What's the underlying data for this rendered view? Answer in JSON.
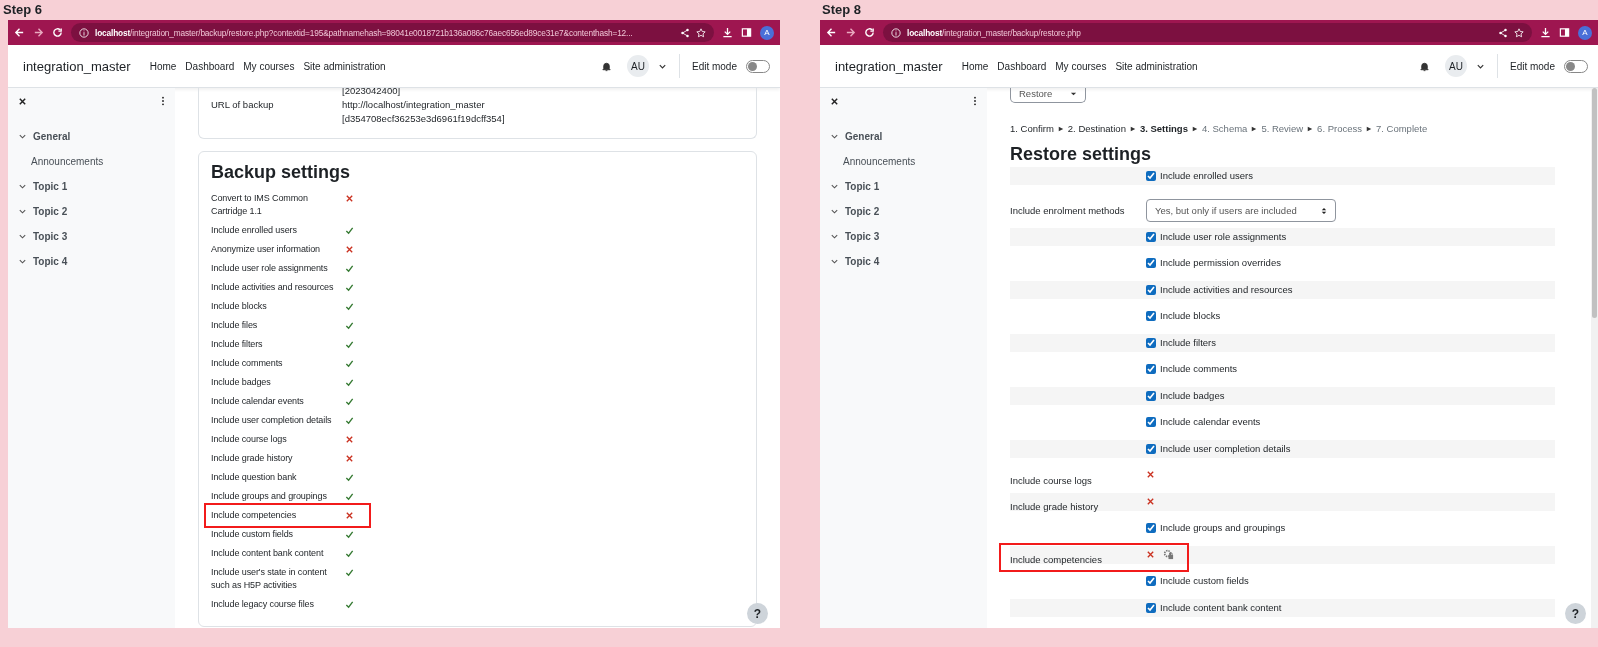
{
  "panels": [
    {
      "kind": "backup",
      "step": "Step 6",
      "url_host": "localhost",
      "url_path": "/integration_master/backup/restore.php?contextid=195&pathnamehash=98041e0018721b136a086c76aec656ed89ce31e7&contenthash=12...",
      "avatar": "A",
      "brand": "integration_master",
      "nav": [
        "Home",
        "Dashboard",
        "My courses",
        "Site administration"
      ],
      "user_initials": "AU",
      "edit_mode": {
        "label": "Edit mode",
        "on": false
      },
      "sidebar": [
        {
          "kind": "section",
          "label": "General"
        },
        {
          "kind": "item",
          "label": "Announcements"
        },
        {
          "kind": "section",
          "label": "Topic 1"
        },
        {
          "kind": "section",
          "label": "Topic 2"
        },
        {
          "kind": "section",
          "label": "Topic 3"
        },
        {
          "kind": "section",
          "label": "Topic 4"
        }
      ],
      "details": [
        {
          "values": [
            "[2023042400]"
          ]
        },
        {
          "label": "URL of backup",
          "values": [
            "http://localhost/integration_master",
            "[d354708ecf36253e3d6961f19dcff354]"
          ]
        }
      ],
      "title": "Backup settings",
      "help_label": "?",
      "settings": [
        {
          "label": "Convert to IMS Common Cartridge 1.1",
          "value": false,
          "highlighted": false
        },
        {
          "label": "Include enrolled users",
          "value": true,
          "highlighted": false
        },
        {
          "label": "Anonymize user information",
          "value": false,
          "highlighted": false
        },
        {
          "label": "Include user role assignments",
          "value": true,
          "highlighted": false
        },
        {
          "label": "Include activities and resources",
          "value": true,
          "highlighted": false
        },
        {
          "label": "Include blocks",
          "value": true,
          "highlighted": false
        },
        {
          "label": "Include files",
          "value": true,
          "highlighted": false
        },
        {
          "label": "Include filters",
          "value": true,
          "highlighted": false
        },
        {
          "label": "Include comments",
          "value": true,
          "highlighted": false
        },
        {
          "label": "Include badges",
          "value": true,
          "highlighted": false
        },
        {
          "label": "Include calendar events",
          "value": true,
          "highlighted": false
        },
        {
          "label": "Include user completion details",
          "value": true,
          "highlighted": false
        },
        {
          "label": "Include course logs",
          "value": false,
          "highlighted": false
        },
        {
          "label": "Include grade history",
          "value": false,
          "highlighted": false
        },
        {
          "label": "Include question bank",
          "value": true,
          "highlighted": false
        },
        {
          "label": "Include groups and groupings",
          "value": true,
          "highlighted": false
        },
        {
          "label": "Include competencies",
          "value": false,
          "highlighted": true
        },
        {
          "label": "Include custom fields",
          "value": true,
          "highlighted": false
        },
        {
          "label": "Include content bank content",
          "value": true,
          "highlighted": false
        },
        {
          "label": "Include user's state in content such as H5P activities",
          "value": true,
          "highlighted": false
        },
        {
          "label": "Include legacy course files",
          "value": true,
          "highlighted": false
        }
      ]
    },
    {
      "kind": "restore",
      "step": "Step 8",
      "url_host": "localhost",
      "url_path": "/integration_master/backup/restore.php",
      "avatar": "A",
      "brand": "integration_master",
      "nav": [
        "Home",
        "Dashboard",
        "My courses",
        "Site administration"
      ],
      "user_initials": "AU",
      "edit_mode": {
        "label": "Edit mode",
        "on": false
      },
      "sidebar": [
        {
          "kind": "section",
          "label": "General"
        },
        {
          "kind": "item",
          "label": "Announcements"
        },
        {
          "kind": "section",
          "label": "Topic 1"
        },
        {
          "kind": "section",
          "label": "Topic 2"
        },
        {
          "kind": "section",
          "label": "Topic 3"
        },
        {
          "kind": "section",
          "label": "Topic 4"
        }
      ],
      "mode_select": "Restore",
      "stepper": [
        {
          "label": "1. Confirm",
          "done": true,
          "current": false
        },
        {
          "label": "2. Destination",
          "done": true,
          "current": false
        },
        {
          "label": "3. Settings",
          "done": false,
          "current": true
        },
        {
          "label": "4. Schema",
          "done": false,
          "current": false
        },
        {
          "label": "5. Review",
          "done": false,
          "current": false
        },
        {
          "label": "6. Process",
          "done": false,
          "current": false
        },
        {
          "label": "7. Complete",
          "done": false,
          "current": false
        }
      ],
      "help_label": "?",
      "title": "Restore settings",
      "settings": [
        {
          "kind": "checkbox",
          "label": "Include enrolled users",
          "checked": true,
          "highlighted": false
        },
        {
          "kind": "select",
          "label": "Include enrolment methods",
          "value": "Yes, but only if users are included",
          "highlighted": false
        },
        {
          "kind": "checkbox",
          "label": "Include user role assignments",
          "checked": true,
          "highlighted": false
        },
        {
          "kind": "checkbox",
          "label": "Include permission overrides",
          "checked": true,
          "highlighted": false
        },
        {
          "kind": "checkbox",
          "label": "Include activities and resources",
          "checked": true,
          "highlighted": false
        },
        {
          "kind": "checkbox",
          "label": "Include blocks",
          "checked": true,
          "highlighted": false
        },
        {
          "kind": "checkbox",
          "label": "Include filters",
          "checked": true,
          "highlighted": false
        },
        {
          "kind": "checkbox",
          "label": "Include comments",
          "checked": true,
          "highlighted": false
        },
        {
          "kind": "checkbox",
          "label": "Include badges",
          "checked": true,
          "highlighted": false
        },
        {
          "kind": "checkbox",
          "label": "Include calendar events",
          "checked": true,
          "highlighted": false
        },
        {
          "kind": "checkbox",
          "label": "Include user completion details",
          "checked": true,
          "highlighted": false
        },
        {
          "kind": "cross",
          "label": "Include course logs",
          "locked": false,
          "highlighted": false
        },
        {
          "kind": "cross",
          "label": "Include grade history",
          "locked": false,
          "highlighted": false
        },
        {
          "kind": "checkbox",
          "label": "Include groups and groupings",
          "checked": true,
          "highlighted": false
        },
        {
          "kind": "cross",
          "label": "Include competencies",
          "locked": true,
          "highlighted": true
        },
        {
          "kind": "checkbox",
          "label": "Include custom fields",
          "checked": true,
          "highlighted": false
        },
        {
          "kind": "checkbox",
          "label": "Include content bank content",
          "checked": true,
          "highlighted": false
        }
      ]
    }
  ]
}
